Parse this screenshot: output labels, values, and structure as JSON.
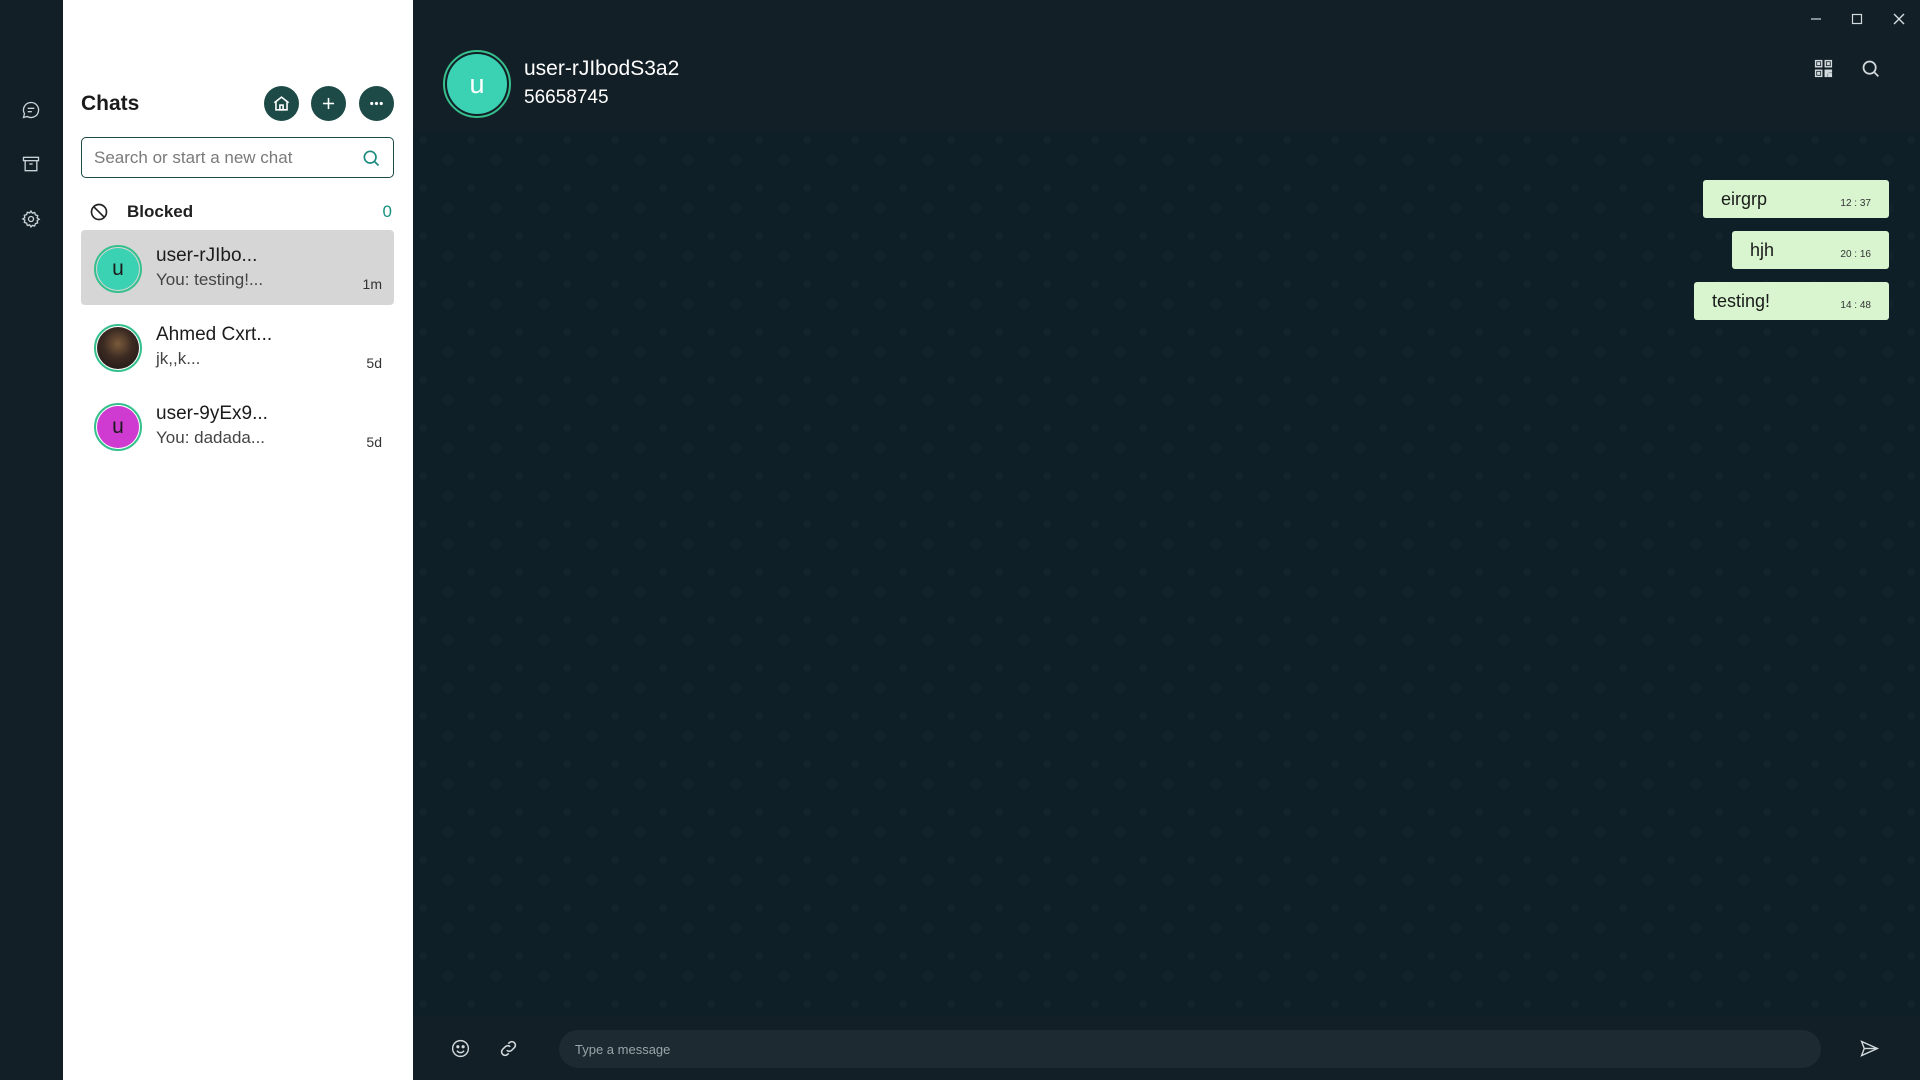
{
  "rail": {
    "items": [
      {
        "icon": "chat-icon"
      },
      {
        "icon": "archive-icon"
      },
      {
        "icon": "gear-icon"
      }
    ]
  },
  "chat_panel": {
    "title": "Chats",
    "buttons": [
      "home-icon",
      "plus-icon",
      "more-icon"
    ],
    "search": {
      "placeholder": "Search or start a new chat",
      "value": ""
    },
    "blocked": {
      "label": "Blocked",
      "count": "0"
    },
    "chats": [
      {
        "name": "user-rJIbo...",
        "preview": "You: testing!...",
        "time": "1m",
        "avatar_letter": "u",
        "avatar_color": "#3ad2b2",
        "active": true
      },
      {
        "name": "Ahmed Cxrt...",
        "preview": "jk,,k...",
        "time": "5d",
        "avatar_letter": "",
        "avatar_color": "#3b2a22",
        "active": false
      },
      {
        "name": "user-9yEx9...",
        "preview": "You: dadada...",
        "time": "5d",
        "avatar_letter": "u",
        "avatar_color": "#cf3ad0",
        "active": false
      }
    ]
  },
  "conversation": {
    "contact_name": "user-rJIbodS3a2",
    "contact_phone": "56658745",
    "avatar_letter": "u",
    "messages": [
      {
        "text": "eirgrp",
        "time": "12 : 37"
      },
      {
        "text": "hjh",
        "time": "20 : 16"
      },
      {
        "text": "testing!",
        "time": "14 : 48"
      }
    ],
    "composer": {
      "placeholder": "Type a message",
      "value": ""
    }
  },
  "colors": {
    "accent": "#1d4a47",
    "bubble": "#d8f5cf",
    "online_ring": "#35c08e"
  }
}
